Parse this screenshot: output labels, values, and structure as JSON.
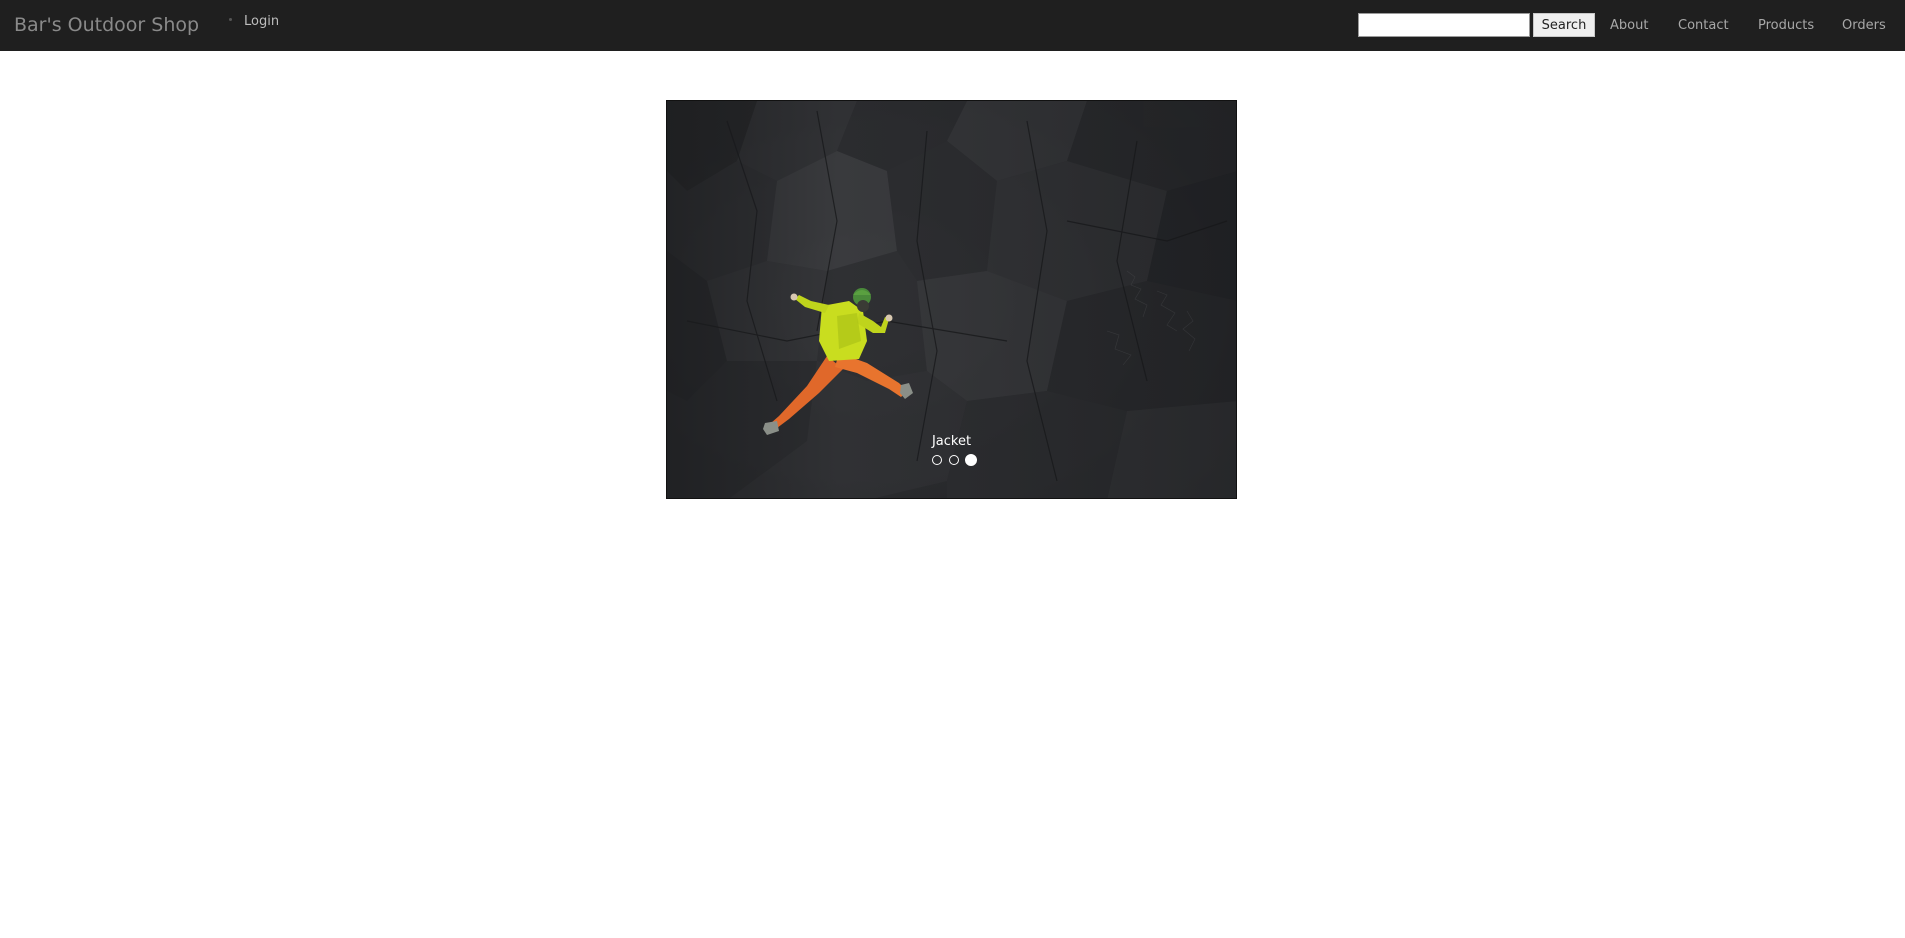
{
  "header": {
    "brand": "Bar's Outdoor Shop",
    "login_label": "Login",
    "search": {
      "value": "",
      "placeholder": "",
      "button_label": "Search"
    },
    "nav": [
      {
        "label": "About"
      },
      {
        "label": "Contact"
      },
      {
        "label": "Products"
      },
      {
        "label": "Orders"
      }
    ]
  },
  "carousel": {
    "caption": "Jacket",
    "slide_count": 3,
    "active_index": 2,
    "image": "person-climbing-dark-rock"
  },
  "colors": {
    "navbar_bg": "#1f1f1f",
    "brand_text": "#8a8a8a",
    "nav_text": "#a8a8a8",
    "jacket": "#c8dc1e",
    "pants": "#e8722a"
  }
}
